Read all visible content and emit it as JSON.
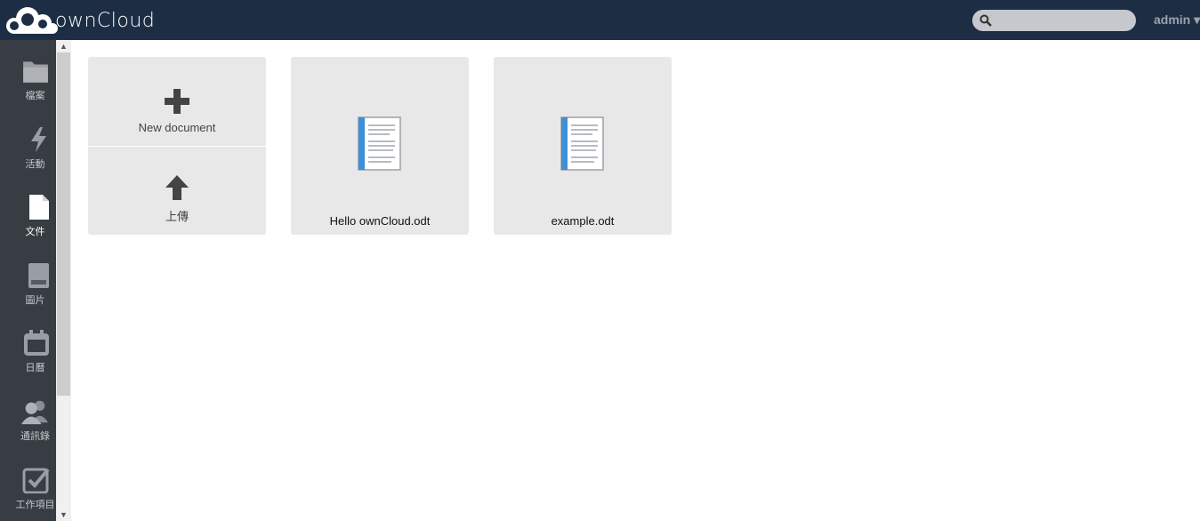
{
  "header": {
    "logo_text": "ownCloud",
    "search_placeholder": "",
    "user": "admin ▾"
  },
  "nav": {
    "items": [
      {
        "label": "檔案",
        "icon": "folder-icon"
      },
      {
        "label": "活動",
        "icon": "lightning-icon"
      },
      {
        "label": "文件",
        "icon": "document-icon"
      },
      {
        "label": "圖片",
        "icon": "image-icon"
      },
      {
        "label": "日曆",
        "icon": "calendar-icon"
      },
      {
        "label": "通訊錄",
        "icon": "contacts-icon"
      },
      {
        "label": "工作項目",
        "icon": "tasks-icon"
      }
    ],
    "active": "文件"
  },
  "actions": {
    "new_document": "New document",
    "upload": "上傳"
  },
  "documents": [
    {
      "name": "Hello ownCloud.odt"
    },
    {
      "name": "example.odt"
    }
  ],
  "colors": {
    "header_bg": "#1d2d44",
    "nav_bg": "#383c43",
    "tile_bg": "#e8e8e8"
  }
}
